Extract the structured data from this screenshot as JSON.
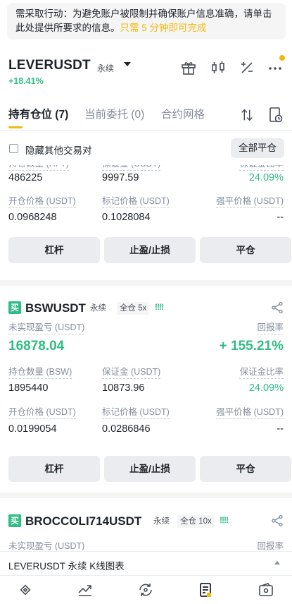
{
  "notice": {
    "text_main": "需采取行动：为避免账户被限制并确保账户信息准确，请单击此处提供所要求的信息。",
    "text_highlight": "只需 5 分钟即可完成"
  },
  "header": {
    "symbol": "LEVERUSDT",
    "perp_tag": "永续",
    "change": "+18.41%",
    "icons": [
      "gift-icon",
      "candlestick-icon",
      "calculator-icon",
      "more-icon"
    ],
    "accent": "#f0b90b"
  },
  "tabs": [
    {
      "label": "持有仓位 (7)",
      "active": true
    },
    {
      "label": "当前委托 (0)",
      "active": false
    },
    {
      "label": "合约网格",
      "active": false
    }
  ],
  "filter": {
    "hide_other_label": "隐藏其他交易对",
    "close_all_label": "全部平仓"
  },
  "positions": [
    {
      "partial": true,
      "top_labels": [
        "持仓数量 (HFT)",
        "保证金 (USDT)",
        "保证金比率"
      ],
      "qty": "486225",
      "margin": "9997.59",
      "margin_ratio": "24.09%",
      "entry_label": "开仓价格 (USDT)",
      "mark_label": "标记价格 (USDT)",
      "liq_label": "强平价格 (USDT)",
      "entry": "0.0968248",
      "mark": "0.1028084",
      "liq": "--"
    },
    {
      "side": "买",
      "symbol": "BSWUSDT",
      "perp_tag": "永续",
      "mode_tag": "全仓 5x",
      "pnl_label": "未实现盈亏 (USDT)",
      "roe_label": "回报率",
      "pnl": "16878.04",
      "roe": "+ 155.21%",
      "qty_label": "持仓数量 (BSW)",
      "margin_label": "保证金 (USDT)",
      "ratio_label": "保证金比率",
      "qty": "1895440",
      "margin": "10873.96",
      "margin_ratio": "24.09%",
      "entry_label": "开仓价格 (USDT)",
      "mark_label": "标记价格 (USDT)",
      "liq_label": "强平价格 (USDT)",
      "entry": "0.0199054",
      "mark": "0.0286846",
      "liq": "--"
    },
    {
      "side": "买",
      "symbol": "BROCCOLI714USDT",
      "perp_tag": "永续",
      "mode_tag": "全仓 10x",
      "pnl_label": "未实现盈亏 (USDT)",
      "roe_label": "回报率"
    }
  ],
  "buttons": {
    "leverage": "杠杆",
    "tpsl": "止盈/止损",
    "close": "平仓"
  },
  "lev_bars": "!!!!",
  "bottom_bar": {
    "label": "LEVERUSDT 永续 K线图表"
  },
  "nav": [
    "home-icon",
    "markets-icon",
    "trade-icon",
    "futures-icon",
    "wallet-icon"
  ],
  "colors": {
    "green": "#2ebd85",
    "accent": "#f0b90b"
  }
}
